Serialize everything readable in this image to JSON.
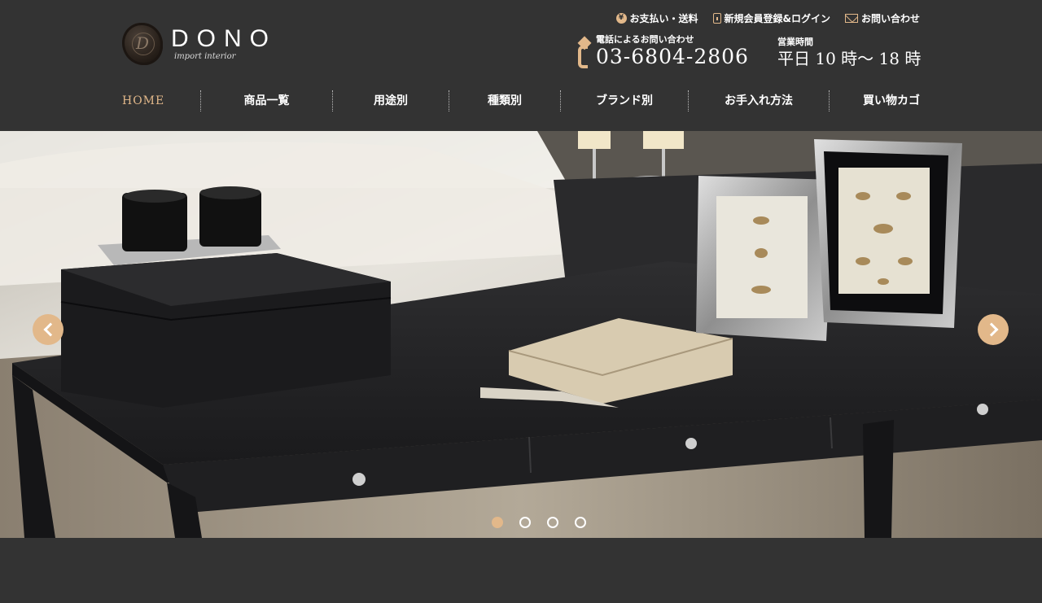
{
  "brand": {
    "name": "DONO",
    "subtitle": "import interior"
  },
  "utility_links": [
    {
      "label": "お支払い・送料",
      "icon": "yen-icon"
    },
    {
      "label": "新規会員登録&ログイン",
      "icon": "lock-icon"
    },
    {
      "label": "お問い合わせ",
      "icon": "mail-icon"
    }
  ],
  "contact": {
    "phone_label": "電話によるお問い合わせ",
    "phone_number": "03-6804-2806",
    "hours_label": "営業時間",
    "hours_value": "平日 10 時〜 18 時"
  },
  "nav": [
    {
      "label": "HOME",
      "active": true
    },
    {
      "label": "商品一覧"
    },
    {
      "label": "用途別"
    },
    {
      "label": "種類別"
    },
    {
      "label": "ブランド別"
    },
    {
      "label": "お手入れ方法"
    },
    {
      "label": "買い物カゴ"
    }
  ],
  "slider": {
    "slide_count": 4,
    "active_slide": 1,
    "slide_image": "bedroom bench with black box, silver frames and open book",
    "prev_icon": "chevron-left-icon",
    "next_icon": "chevron-right-icon"
  },
  "colors": {
    "background": "#333333",
    "accent": "#e2b88a",
    "text": "#ffffff"
  }
}
